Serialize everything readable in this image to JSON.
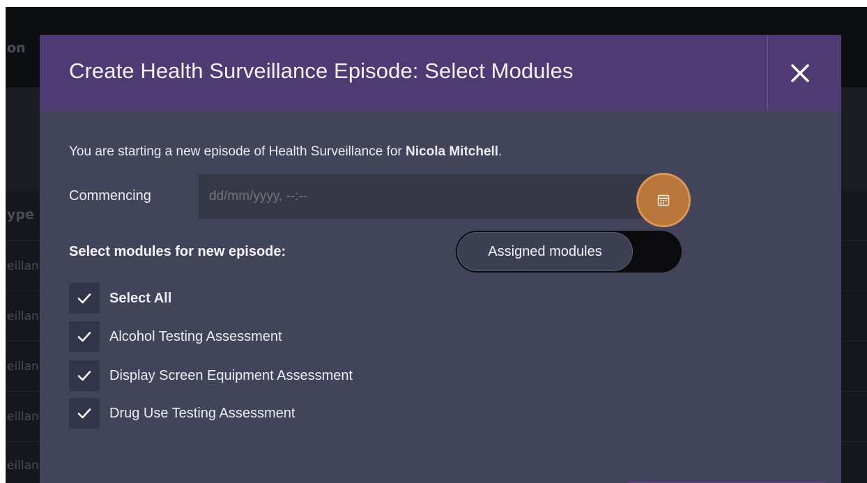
{
  "background": {
    "header_fragment": "on",
    "column_fragment": "ype",
    "row_fragments": [
      "eillanc",
      "eillanc",
      "eillanc",
      "eillanc",
      "eillanc"
    ]
  },
  "modal": {
    "title": "Create Health Surveillance Episode: Select Modules",
    "intro_prefix": "You are starting a new episode of Health Surveillance for ",
    "patient_name": "Nicola Mitchell",
    "intro_suffix": ".",
    "commencing_label": "Commencing",
    "date_placeholder": "dd/mm/yyyy, --:--",
    "select_label": "Select modules for new episode:",
    "toggle_label": "Assigned modules",
    "modules": [
      {
        "label": "Select All",
        "checked": true
      },
      {
        "label": "Alcohol Testing Assessment",
        "checked": true
      },
      {
        "label": "Display Screen Equipment Assessment",
        "checked": true
      },
      {
        "label": "Drug Use Testing Assessment",
        "checked": true
      }
    ]
  },
  "colors": {
    "header": "#4f3b73",
    "body": "#424459",
    "accent": "#c07a3b"
  }
}
